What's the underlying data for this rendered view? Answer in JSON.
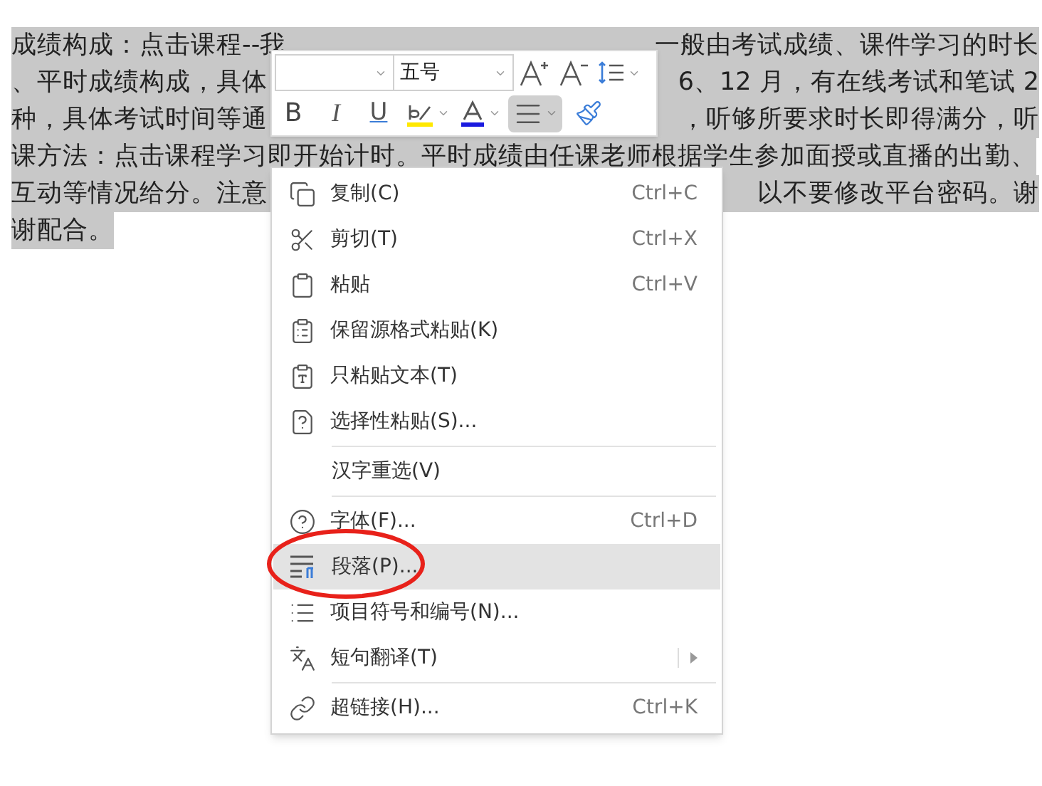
{
  "document": {
    "lines": [
      {
        "segments": [
          "成绩构成：点击课程--我",
          "一般由考试成绩、课件学习的时长"
        ]
      },
      {
        "segments": [
          "、平时成绩构成，具体",
          "6、12 月，有在线考试和笔试 2"
        ]
      },
      {
        "segments": [
          "种，具体考试时间等通",
          "，听够所要求时长即得满分，听"
        ]
      },
      {
        "segments": [
          "课方法：点击课程学习即开始计时。平时成绩由任课老师根据学生参加面授或直播的出勤、"
        ]
      },
      {
        "segments": [
          "互动等情况给分。注意",
          "以不要修改平台密码。谢"
        ]
      },
      {
        "segments": [
          "谢配合。"
        ]
      }
    ]
  },
  "mini_toolbar": {
    "font_size": "五号",
    "format_buttons": [
      {
        "kind": "bold",
        "label": "B",
        "selected": false
      },
      {
        "kind": "italic",
        "label": "I",
        "selected": false
      },
      {
        "kind": "underline",
        "label": "U",
        "selected": false
      },
      {
        "kind": "highlight",
        "selected": false
      },
      {
        "kind": "font-color",
        "selected": false
      },
      {
        "kind": "align",
        "selected": true
      },
      {
        "kind": "painter",
        "selected": false
      }
    ]
  },
  "context_menu": {
    "items": [
      {
        "kind": "item",
        "label": "复制(C)",
        "shortcut": "Ctrl+C",
        "selected": false
      },
      {
        "kind": "item",
        "label": "剪切(T)",
        "shortcut": "Ctrl+X",
        "selected": false
      },
      {
        "kind": "item",
        "label": "粘贴",
        "shortcut": "Ctrl+V",
        "selected": false
      },
      {
        "kind": "item",
        "label": "保留源格式粘贴(K)",
        "selected": false
      },
      {
        "kind": "item",
        "label": "只粘贴文本(T)",
        "selected": false
      },
      {
        "kind": "item",
        "label": "选择性粘贴(S)...",
        "selected": false
      },
      {
        "kind": "separator"
      },
      {
        "kind": "item",
        "label": "汉字重选(V)",
        "selected": false
      },
      {
        "kind": "separator"
      },
      {
        "kind": "item",
        "label": "字体(F)...",
        "shortcut": "Ctrl+D",
        "selected": false
      },
      {
        "kind": "item",
        "label": "段落(P)...",
        "selected": true
      },
      {
        "kind": "item",
        "label": "项目符号和编号(N)...",
        "selected": false
      },
      {
        "kind": "item",
        "label": "短句翻译(T)",
        "submenu": true,
        "selected": false
      },
      {
        "kind": "separator"
      },
      {
        "kind": "item",
        "label": "超链接(H)...",
        "shortcut": "Ctrl+K",
        "selected": false
      }
    ]
  },
  "annotation": {
    "kind": "ellipse",
    "color": "#e8211a"
  }
}
